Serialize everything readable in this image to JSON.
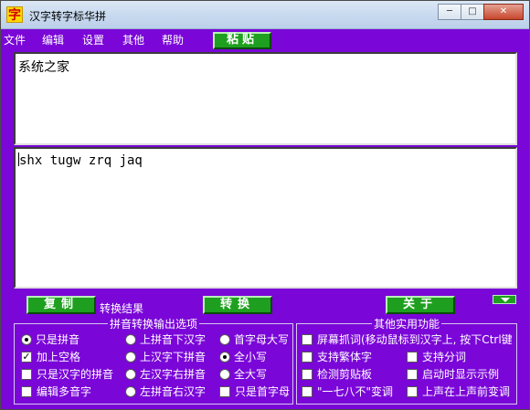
{
  "window": {
    "icon_char": "字",
    "title": "汉字转字标华拼",
    "minimize": "─",
    "maximize": "□",
    "close": "✕"
  },
  "menu": {
    "items": [
      "文件",
      "编辑",
      "设置",
      "其他",
      "帮助"
    ],
    "paste": "粘贴"
  },
  "input_text": "系统之家",
  "output_text": "shx tugw zrq jaq",
  "buttons": {
    "copy": "复制",
    "result_label": "转换结果",
    "convert": "转换",
    "about": "关于"
  },
  "pinyin_group": {
    "legend": "拼音转换输出选项",
    "options": [
      {
        "label": "只是拼音",
        "type": "radio",
        "checked": true
      },
      {
        "label": "上拼音下汉字",
        "type": "radio",
        "checked": false
      },
      {
        "label": "首字母大写",
        "type": "radio",
        "checked": false
      },
      {
        "label": "加上空格",
        "type": "checkbox",
        "checked": true
      },
      {
        "label": "上汉字下拼音",
        "type": "radio",
        "checked": false
      },
      {
        "label": "全小写",
        "type": "radio",
        "checked": true
      },
      {
        "label": "只是汉字的拼音",
        "type": "checkbox",
        "checked": false
      },
      {
        "label": "左汉字右拼音",
        "type": "radio",
        "checked": false
      },
      {
        "label": "全大写",
        "type": "radio",
        "checked": false
      },
      {
        "label": "编辑多音字",
        "type": "checkbox",
        "checked": false
      },
      {
        "label": "左拼音右汉字",
        "type": "radio",
        "checked": false
      },
      {
        "label": "只是首字母",
        "type": "checkbox",
        "checked": false
      }
    ]
  },
  "other_group": {
    "legend": "其他实用功能",
    "options": [
      {
        "label": "屏幕抓词(移动鼠标到汉字上, 按下Ctrl键",
        "checked": false
      },
      {
        "label": "支持繁体字",
        "checked": false
      },
      {
        "label": "支持分词",
        "checked": false
      },
      {
        "label": "检测剪贴板",
        "checked": false
      },
      {
        "label": "启动时显示示例",
        "checked": false
      },
      {
        "label": "\"一七八不\"变调",
        "checked": false
      },
      {
        "label": "上声在上声前变调",
        "checked": false
      }
    ]
  }
}
